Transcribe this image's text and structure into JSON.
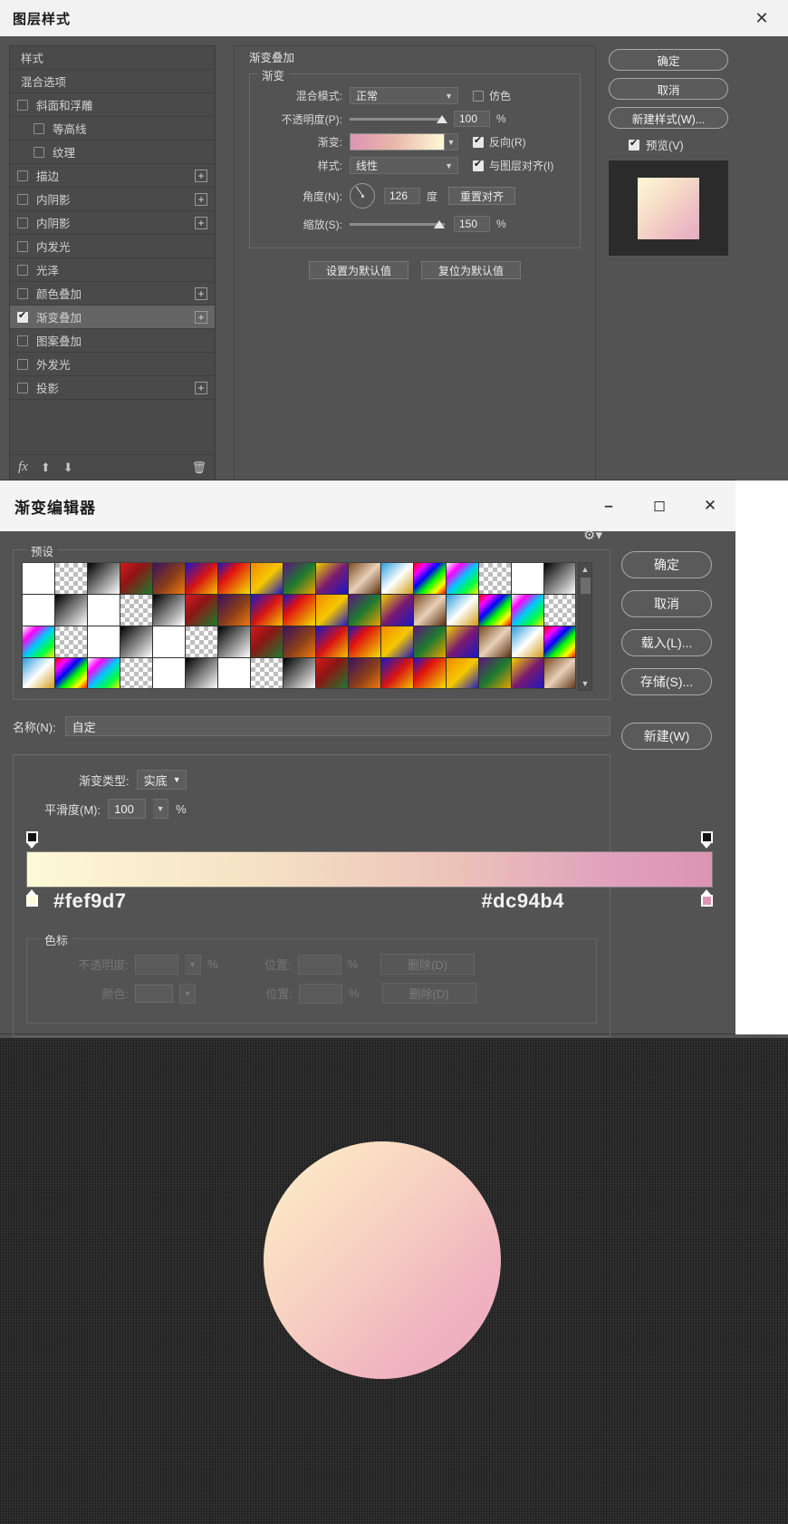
{
  "layer_style": {
    "title": "图层样式",
    "close_icon": "close-icon",
    "sidebar": {
      "items": [
        {
          "label": "样式",
          "type": "plain"
        },
        {
          "label": "混合选项",
          "type": "plain"
        },
        {
          "label": "斜面和浮雕",
          "type": "check",
          "checked": false,
          "plus": false,
          "indent": false
        },
        {
          "label": "等高线",
          "type": "check",
          "checked": false,
          "plus": false,
          "indent": true
        },
        {
          "label": "纹理",
          "type": "check",
          "checked": false,
          "plus": false,
          "indent": true
        },
        {
          "label": "描边",
          "type": "check",
          "checked": false,
          "plus": true,
          "indent": false
        },
        {
          "label": "内阴影",
          "type": "check",
          "checked": false,
          "plus": true,
          "indent": false
        },
        {
          "label": "内阴影",
          "type": "check",
          "checked": false,
          "plus": true,
          "indent": false
        },
        {
          "label": "内发光",
          "type": "check",
          "checked": false,
          "plus": false,
          "indent": false
        },
        {
          "label": "光泽",
          "type": "check",
          "checked": false,
          "plus": false,
          "indent": false
        },
        {
          "label": "颜色叠加",
          "type": "check",
          "checked": false,
          "plus": true,
          "indent": false
        },
        {
          "label": "渐变叠加",
          "type": "check",
          "checked": true,
          "plus": true,
          "indent": false,
          "selected": true
        },
        {
          "label": "图案叠加",
          "type": "check",
          "checked": false,
          "plus": true,
          "indent": false
        },
        {
          "label": "外发光",
          "type": "check",
          "checked": false,
          "plus": false,
          "indent": false
        },
        {
          "label": "投影",
          "type": "check",
          "checked": false,
          "plus": true,
          "indent": false
        }
      ],
      "footer": {
        "fx_label": "fx",
        "up_icon": "arrow-up-icon",
        "down_icon": "arrow-down-icon",
        "trash_icon": "trash-icon"
      }
    },
    "panel": {
      "section_title": "渐变叠加",
      "group_title": "渐变",
      "blend_mode_label": "混合模式:",
      "blend_mode_value": "正常",
      "dither_label": "仿色",
      "dither_checked": false,
      "opacity_label": "不透明度(P):",
      "opacity_value": "100",
      "opacity_unit": "%",
      "gradient_label": "渐变:",
      "gradient_css": "linear-gradient(90deg, #dc94b4 0%, #e8b6aa 45%, #fef9d7 100%)",
      "reverse_label": "反向(R)",
      "reverse_checked": true,
      "style_label": "样式:",
      "style_value": "线性",
      "align_label": "与图层对齐(I)",
      "align_checked": true,
      "angle_label": "角度(N):",
      "angle_value": "126",
      "angle_unit": "度",
      "reset_align_button": "重置对齐",
      "scale_label": "缩放(S):",
      "scale_value": "150",
      "scale_unit": "%",
      "set_default_button": "设置为默认值",
      "reset_default_button": "复位为默认值"
    },
    "actions": {
      "ok": "确定",
      "cancel": "取消",
      "new_style": "新建样式(W)...",
      "preview_label": "预览(V)",
      "preview_checked": true
    }
  },
  "gradient_editor": {
    "title": "渐变编辑器",
    "minimize_icon": "minimize-icon",
    "maximize_icon": "maximize-icon",
    "close_icon": "close-icon",
    "presets_legend": "预设",
    "gear_icon": "gear-icon",
    "scroll_up_icon": "chevron-up-icon",
    "scroll_down_icon": "chevron-down-icon",
    "name_label": "名称(N):",
    "name_value": "自定",
    "new_button": "新建(W)",
    "gradient_type_label": "渐变类型:",
    "gradient_type_value": "实底",
    "smoothness_label": "平滑度(M):",
    "smoothness_value": "100",
    "smoothness_unit": "%",
    "gradient_css": "linear-gradient(90deg, #fef9d7 0%, #f5e2c4 33%, #ecc3b9 62%, #e0a1bd 85%, #dc94b4 100%)",
    "hex_left": "#fef9d7",
    "hex_right": "#dc94b4",
    "stops_legend": "色标",
    "opacity_label": "不透明度:",
    "opacity_unit": "%",
    "position_label": "位置:",
    "position_unit": "%",
    "delete_label": "删除(D)",
    "color_label": "颜色:",
    "position_label2": "位置:",
    "position_unit2": "%",
    "delete_label2": "删除(D)",
    "actions": {
      "ok": "确定",
      "cancel": "取消",
      "load": "载入(L)...",
      "save": "存储(S)..."
    },
    "preset_swatches": [
      "linear-gradient(135deg,#ffffff,#ffffff)",
      "checker",
      "linear-gradient(135deg,#000000,#ffffff)",
      "linear-gradient(135deg,#d21b1b 0%,#8e1515 40%,#1d7a2e 100%)",
      "linear-gradient(135deg,#3b1060 0%,#8a3f18 55%,#f07a10 100%)",
      "linear-gradient(135deg,#1a17c4 0%,#d61414 50%,#f5c400 100%)",
      "linear-gradient(135deg,#1a17c4 0%,#e01010 35%,#f2e000 100%)",
      "linear-gradient(135deg,#f08a00 0%,#f5c800 50%,#1a17c4 100%)",
      "linear-gradient(135deg,#5e1480 0%,#1d7a2e 50%,#f0a000 100%)",
      "linear-gradient(135deg,#f2d000 0%,#7a1a70 50%,#1a17c4 100%)",
      "linear-gradient(135deg,#7a4a20 0%,#e8d0b8 50%,#5a3010 100%)",
      "linear-gradient(135deg,#2a9bdc 0%,#ffffff 50%,#d09a10 100%)",
      "linear-gradient(135deg,#ff0000,#ff00ff,#0000ff,#00ff00,#ffff00,#ff0000)",
      "linear-gradient(135deg,#ffffff,#ff00ff,#00c8ff,#00ff40,#ffee00)",
      "checker",
      "linear-gradient(135deg,#ffffff,#ffffff)",
      "linear-gradient(135deg,#000000,#ffffff)"
    ]
  },
  "canvas": {
    "shape_name": "gradient-circle",
    "shape_gradient": "linear-gradient(135deg, #fdf0cf 0%, #fbe0c3 22%, #f6ccc1 48%, #f0b4c0 74%, #eca7bd 100%)",
    "background": "#2b2b2b"
  }
}
